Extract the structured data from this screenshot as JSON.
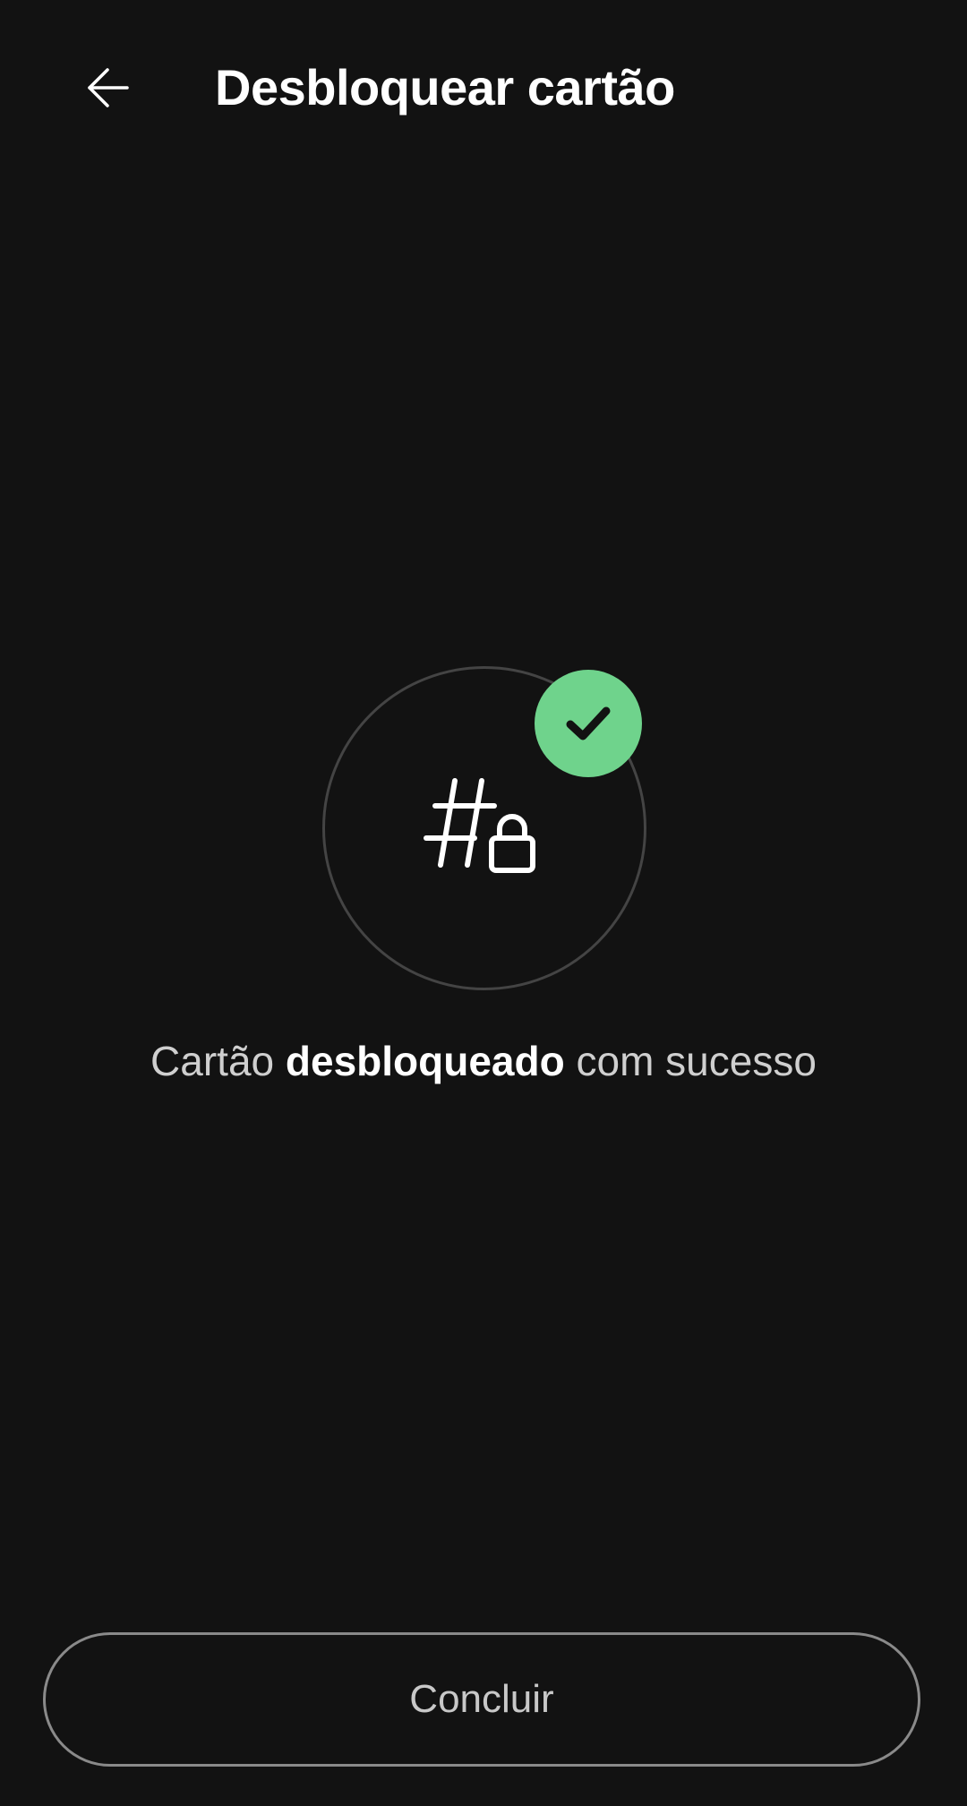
{
  "header": {
    "back_icon": "arrow-left-icon",
    "title": "Desbloquear cartão"
  },
  "status": {
    "main_icon": "card-number-lock-icon",
    "badge_icon": "check-icon",
    "badge_color": "#6fd38c",
    "message_prefix": "Cartão",
    "message_emphasis": "desbloqueado",
    "message_suffix": "com sucesso"
  },
  "actions": {
    "primary_label": "Concluir"
  }
}
